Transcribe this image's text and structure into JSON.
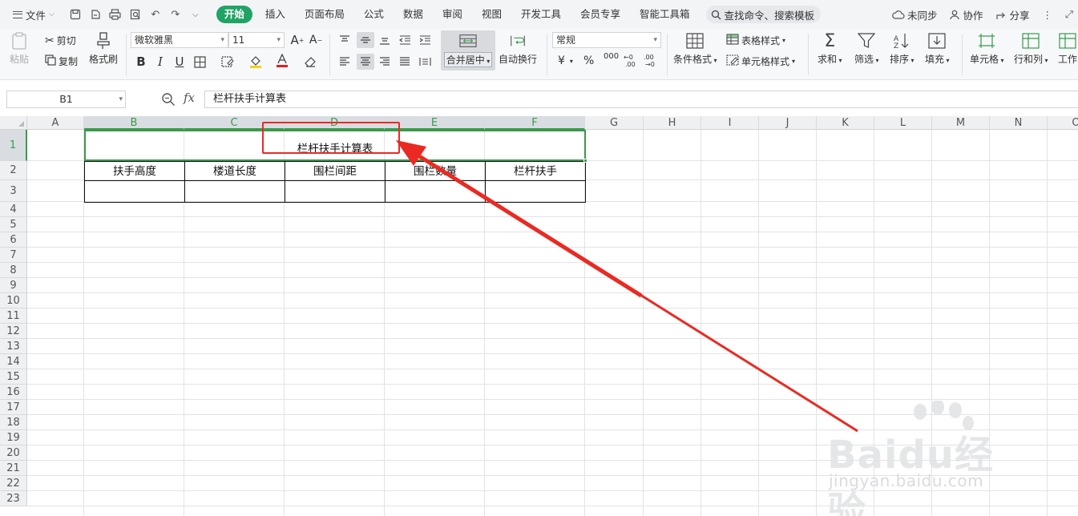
{
  "menubar": {
    "file_label": "文件",
    "tabs": [
      "开始",
      "插入",
      "页面布局",
      "公式",
      "数据",
      "审阅",
      "视图",
      "开发工具",
      "会员专享",
      "智能工具箱"
    ],
    "search_label": "查找命令、搜索模板",
    "right": {
      "sync": "未同步",
      "collab": "协作",
      "share": "分享"
    }
  },
  "ribbon": {
    "paste": "粘贴",
    "cut": "剪切",
    "copy": "复制",
    "format_painter": "格式刷",
    "font_name": "微软雅黑",
    "font_size": "11",
    "merge_center": "合并居中",
    "wrap_text": "自动换行",
    "number_format": "常规",
    "currency_symbol": "¥",
    "percent_symbol": "%",
    "thousands": "000",
    "cond_format": "条件格式",
    "table_style": "表格样式",
    "cell_style": "单元格样式",
    "sum": "求和",
    "filter": "筛选",
    "sort": "排序",
    "fill": "填充",
    "cell": "单元格",
    "rowcol": "行和列",
    "worksheet": "工作"
  },
  "formula_bar": {
    "name_box": "B1",
    "fx": "fx",
    "content": "栏杆扶手计算表"
  },
  "sheet": {
    "columns": [
      "A",
      "B",
      "C",
      "D",
      "E",
      "F",
      "G",
      "H",
      "I",
      "J",
      "K",
      "L",
      "M",
      "N",
      "O"
    ],
    "rows": [
      "1",
      "2",
      "3",
      "4",
      "5",
      "6",
      "7",
      "8",
      "9",
      "10",
      "11",
      "12",
      "13",
      "14",
      "15",
      "16",
      "17",
      "18",
      "19",
      "20",
      "21",
      "22",
      "23"
    ],
    "title": "栏杆扶手计算表",
    "headers": [
      "扶手高度",
      "楼道长度",
      "围栏间距",
      "围栏数量",
      "栏杆扶手"
    ],
    "selected_cell": "B1"
  },
  "watermark": {
    "brand": "Baidu经验",
    "site": "jingyan.baidu.com"
  },
  "colors": {
    "accent_green": "#21a366",
    "selection_green": "#3a9a4b",
    "annotation_red": "#ea2a22"
  }
}
